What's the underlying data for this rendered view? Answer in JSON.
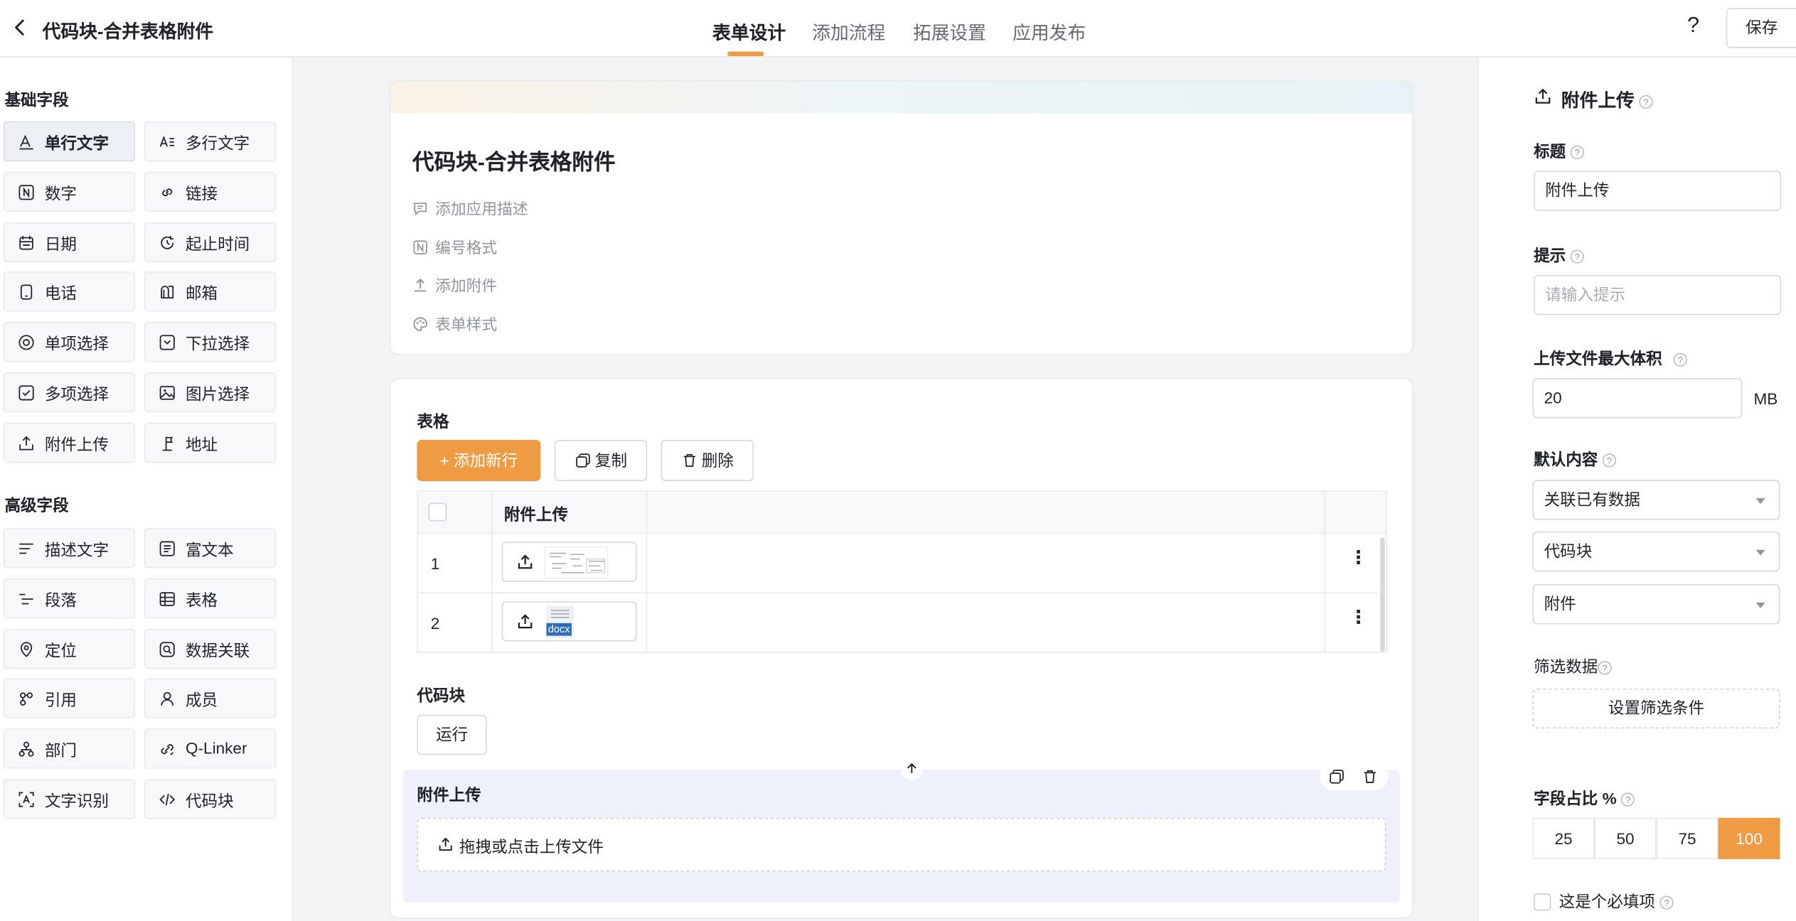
{
  "header": {
    "title": "代码块-合并表格附件",
    "tabs": [
      "表单设计",
      "添加流程",
      "拓展设置",
      "应用发布"
    ],
    "active_tab": "表单设计",
    "help_label": "?",
    "save_label": "保存"
  },
  "left_panel": {
    "basic_title": "基础字段",
    "basic_fields": [
      {
        "label": "单行文字",
        "icon": "text-a-icon"
      },
      {
        "label": "多行文字",
        "icon": "multiline-text-icon"
      },
      {
        "label": "数字",
        "icon": "number-n-icon"
      },
      {
        "label": "链接",
        "icon": "link-icon"
      },
      {
        "label": "日期",
        "icon": "calendar-icon"
      },
      {
        "label": "起止时间",
        "icon": "time-range-icon"
      },
      {
        "label": "电话",
        "icon": "phone-icon"
      },
      {
        "label": "邮箱",
        "icon": "mailbox-icon"
      },
      {
        "label": "单项选择",
        "icon": "radio-icon"
      },
      {
        "label": "下拉选择",
        "icon": "dropdown-icon"
      },
      {
        "label": "多项选择",
        "icon": "checkbox-icon"
      },
      {
        "label": "图片选择",
        "icon": "image-icon"
      },
      {
        "label": "附件上传",
        "icon": "upload-icon"
      },
      {
        "label": "地址",
        "icon": "address-icon"
      }
    ],
    "advanced_title": "高级字段",
    "advanced_fields": [
      {
        "label": "描述文字",
        "icon": "description-icon"
      },
      {
        "label": "富文本",
        "icon": "rich-text-icon"
      },
      {
        "label": "段落",
        "icon": "paragraph-icon"
      },
      {
        "label": "表格",
        "icon": "table-icon"
      },
      {
        "label": "定位",
        "icon": "location-icon"
      },
      {
        "label": "数据关联",
        "icon": "data-link-icon"
      },
      {
        "label": "引用",
        "icon": "reference-icon"
      },
      {
        "label": "成员",
        "icon": "member-icon"
      },
      {
        "label": "部门",
        "icon": "department-icon"
      },
      {
        "label": "Q-Linker",
        "icon": "qlinker-icon"
      },
      {
        "label": "文字识别",
        "icon": "ocr-icon"
      },
      {
        "label": "代码块",
        "icon": "code-icon"
      }
    ]
  },
  "canvas": {
    "form_title": "代码块-合并表格附件",
    "meta": [
      {
        "label": "添加应用描述",
        "icon": "comment-icon"
      },
      {
        "label": "编号格式",
        "icon": "number-n-icon"
      },
      {
        "label": "添加附件",
        "icon": "upload-icon"
      },
      {
        "label": "表单样式",
        "icon": "palette-icon"
      }
    ],
    "table_section": {
      "label": "表格",
      "add_row_label": "+ 添加新行",
      "copy_label": "复制",
      "delete_label": "删除",
      "column_header": "附件上传",
      "rows": [
        {
          "num": "1",
          "attachment": "screenshot-thumbnail"
        },
        {
          "num": "2",
          "attachment": "docx"
        }
      ],
      "docx_badge": "docx"
    },
    "code_section": {
      "label": "代码块",
      "run_label": "运行"
    },
    "upload_section": {
      "label": "附件上传",
      "drop_text": "拖拽或点击上传文件"
    }
  },
  "right_panel": {
    "title": "附件上传",
    "title_label": "标题",
    "title_value": "附件上传",
    "hint_label": "提示",
    "hint_placeholder": "请输入提示",
    "max_size_label": "上传文件最大体积",
    "max_size_value": "20",
    "max_size_unit": "MB",
    "default_label": "默认内容",
    "default_selects": [
      "关联已有数据",
      "代码块",
      "附件"
    ],
    "filter_label": "筛选数据",
    "filter_button": "设置筛选条件",
    "width_label": "字段占比 %",
    "width_options": [
      "25",
      "50",
      "75",
      "100"
    ],
    "width_selected": "100",
    "required_label": "这是个必填项"
  },
  "colors": {
    "accent": "#ef9b44",
    "border": "#e8e9eb",
    "text": "#1f2329",
    "muted": "#8f959e",
    "upload_bg": "#eef1fb"
  }
}
